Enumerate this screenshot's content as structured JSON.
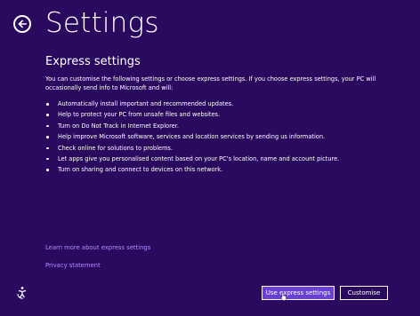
{
  "page": {
    "title": "Settings",
    "subtitle": "Express settings",
    "intro": "You can customise the following settings or choose express settings. If you choose express settings, your PC will occasionally send info to Microsoft and will:"
  },
  "bullets": [
    "Automatically install important and recommended updates.",
    "Help to protect your PC from unsafe files and websites.",
    "Turn on Do Not Track in Internet Explorer.",
    "Help improve Microsoft software, services and location services by sending us information.",
    "Check online for solutions to problems.",
    "Let apps give you personalised content based on your PC's location, name and account picture.",
    "Turn on sharing and connect to devices on this network."
  ],
  "links": {
    "learn_more": "Learn more about express settings",
    "privacy": "Privacy statement"
  },
  "buttons": {
    "express": "Use express settings",
    "customise": "Customise"
  },
  "colors": {
    "background": "#2a0a5e",
    "accent": "#6a3fd6",
    "link": "#b58cff"
  },
  "icons": {
    "back": "back-arrow-icon",
    "accessibility": "ease-of-access-icon"
  }
}
